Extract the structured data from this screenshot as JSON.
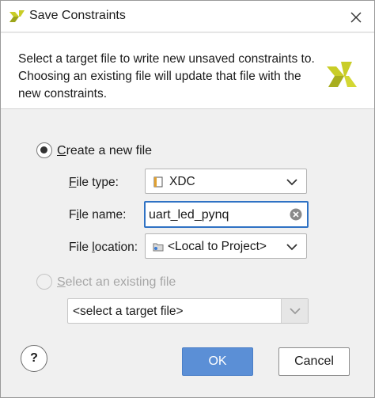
{
  "window": {
    "title": "Save Constraints",
    "close_icon": "close-icon"
  },
  "header": {
    "description": "Select a target file to write new unsaved constraints to. Choosing an existing file will update that file with the new constraints."
  },
  "options": {
    "create_new": {
      "label_accel": "C",
      "label_rest": "reate a new file",
      "selected": true
    },
    "select_existing": {
      "label_accel": "S",
      "label_rest": "elect an existing file",
      "selected": false,
      "enabled": false
    }
  },
  "form": {
    "file_type": {
      "label_accel": "F",
      "label_rest": "ile type:",
      "value": "XDC",
      "icon": "file-icon"
    },
    "file_name": {
      "label_pre": "F",
      "label_accel": "i",
      "label_rest": "le name:",
      "value": "uart_led_pynq",
      "clear_icon": "clear-icon"
    },
    "file_location": {
      "label_pre": "File ",
      "label_accel": "l",
      "label_rest": "ocation:",
      "value": "<Local to Project>",
      "icon": "folder-icon"
    },
    "existing_file": {
      "value": "<select a target file>"
    }
  },
  "buttons": {
    "help": "?",
    "ok": "OK",
    "cancel": "Cancel"
  },
  "colors": {
    "ok_button": "#5b8fd6",
    "input_focus": "#2f72c4",
    "logo_yellow": "#c9cd27"
  }
}
